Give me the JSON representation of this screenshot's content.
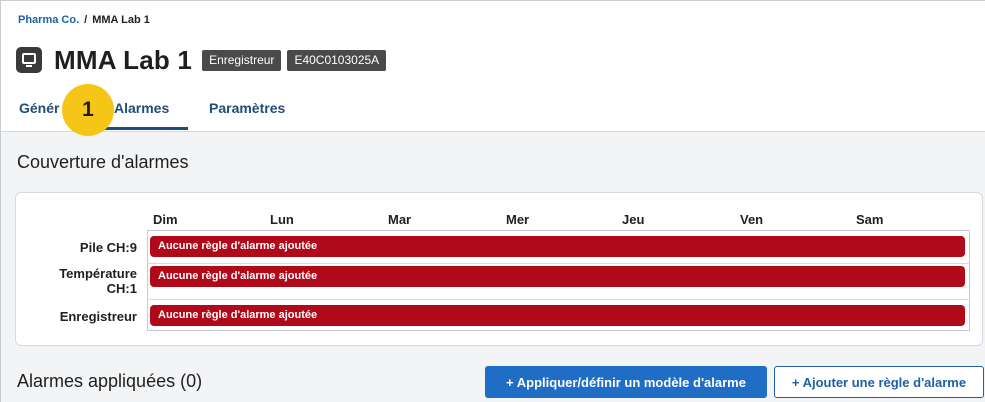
{
  "breadcrumb": {
    "root": "Pharma Co.",
    "separator": "/",
    "current": "MMA Lab 1"
  },
  "title": {
    "text": "MMA Lab 1",
    "icon": "logger-device-icon",
    "tags": [
      "Enregistreur",
      "E40C0103025A"
    ]
  },
  "tabs": [
    {
      "label": "Génér"
    },
    {
      "label": "Alarmes",
      "active": true
    },
    {
      "label": "Paramètres"
    }
  ],
  "step_badge": "1",
  "coverage": {
    "title": "Couverture d'alarmes",
    "days": [
      "Dim",
      "Lun",
      "Mar",
      "Mer",
      "Jeu",
      "Ven",
      "Sam"
    ],
    "rows": [
      {
        "label_line1": "Pile CH:9",
        "label_line2": "",
        "bar_text": "Aucune règle d'alarme ajoutée"
      },
      {
        "label_line1": "Température",
        "label_line2": "CH:1",
        "bar_text": "Aucune règle d'alarme ajoutée"
      },
      {
        "label_line1": "Enregistreur",
        "label_line2": "",
        "bar_text": "Aucune règle d'alarme ajoutée"
      }
    ]
  },
  "applied": {
    "title": "Alarmes appliquées (0)",
    "apply_template_label": "+ Appliquer/définir un modèle d'alarme",
    "add_rule_label": "+ Ajouter une règle d'alarme"
  },
  "colors": {
    "accent": "#1f6dc4",
    "alarm_bar": "#b0091a",
    "step_badge": "#f5c518",
    "tab_active": "#1f4d7a"
  }
}
